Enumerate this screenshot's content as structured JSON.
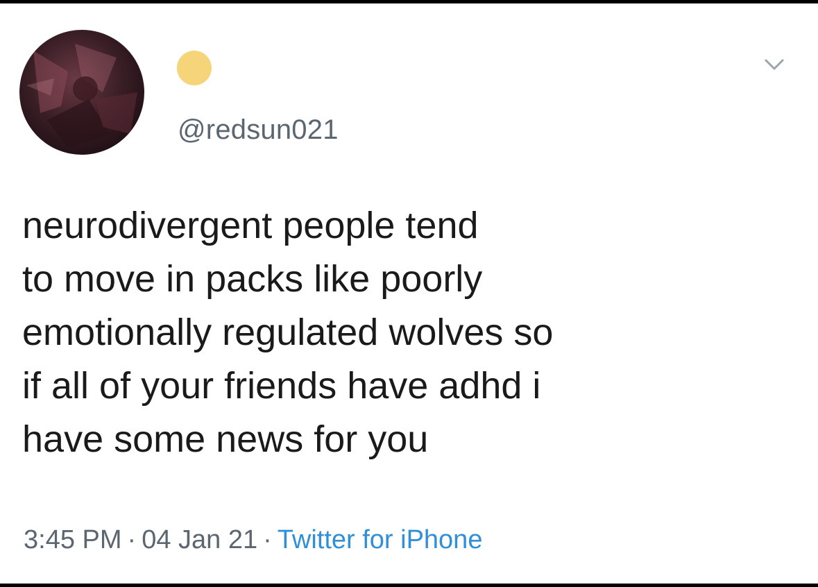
{
  "tweet": {
    "handle": "@redsun021",
    "text_lines": [
      "neurodivergent people tend",
      "to move in packs like poorly",
      "emotionally regulated wolves so",
      "if all of your friends have adhd i",
      "have some news for you"
    ],
    "time": "3:45 PM",
    "date": "04 Jan 21",
    "separator": "·",
    "source": "Twitter for iPhone"
  },
  "icons": {
    "status": "status-dot-icon",
    "menu": "chevron-down-icon"
  },
  "colors": {
    "status_dot": "#f6d47a",
    "secondary_text": "#5b6670",
    "link": "#2f8fd8",
    "body_text": "#1a1a1a"
  }
}
